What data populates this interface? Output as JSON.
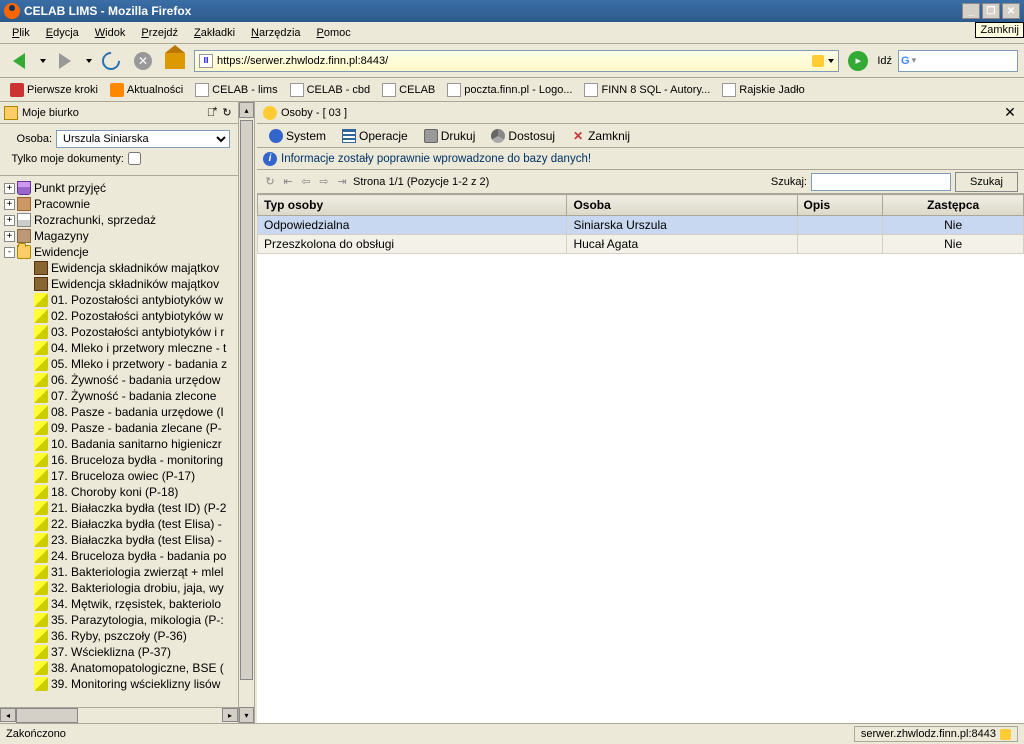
{
  "window_title": "CELAB LIMS - Mozilla Firefox",
  "close_tooltip": "Zamknij",
  "menubar": [
    "Plik",
    "Edycja",
    "Widok",
    "Przejdź",
    "Zakładki",
    "Narzędzia",
    "Pomoc"
  ],
  "url": "https://serwer.zhwlodz.finn.pl:8443/",
  "go_label": "Idź",
  "bookmarks": [
    {
      "label": "Pierwsze kroki",
      "type": "red"
    },
    {
      "label": "Aktualności",
      "type": "rss"
    },
    {
      "label": "CELAB - lims",
      "type": "page"
    },
    {
      "label": "CELAB - cbd",
      "type": "page"
    },
    {
      "label": "CELAB",
      "type": "page"
    },
    {
      "label": "poczta.finn.pl - Logo...",
      "type": "page"
    },
    {
      "label": "FINN 8 SQL - Autory...",
      "type": "page"
    },
    {
      "label": "Rajskie Jadło",
      "type": "page"
    }
  ],
  "sidebar": {
    "title": "Moje biurko",
    "filter_osoba_label": "Osoba:",
    "filter_osoba_value": "Urszula Siniarska",
    "filter_docs_label": "Tylko moje dokumenty:",
    "tree_top": [
      {
        "icon": "beaker",
        "label": "Punkt przyjęć",
        "exp": "+"
      },
      {
        "icon": "bricks",
        "label": "Pracownie",
        "exp": "+"
      },
      {
        "icon": "items",
        "label": "Rozrachunki, sprzedaż",
        "exp": "+"
      },
      {
        "icon": "box",
        "label": "Magazyny",
        "exp": "+"
      },
      {
        "icon": "folder",
        "label": "Ewidencje",
        "exp": "-"
      }
    ],
    "tree_evid_sub": [
      {
        "icon": "trunk",
        "label": "Ewidencja składników majątkov"
      },
      {
        "icon": "trunk",
        "label": "Ewidencja składników majątkov"
      }
    ],
    "tree_yellow": [
      "01. Pozostałości antybiotyków w",
      "02. Pozostałości antybiotyków w",
      "03. Pozostałości antybiotyków i r",
      "04. Mleko i przetwory mleczne - t",
      "05. Mleko i przetwory - badania z",
      "06. Żywność - badania urzędow",
      "07. Żywność - badania zlecone",
      "08. Pasze - badania urzędowe (I",
      "09. Pasze - badania zlecane (P-",
      "10. Badania sanitarno higieniczr",
      "16. Bruceloza bydła - monitoring",
      "17. Bruceloza owiec (P-17)",
      "18. Choroby koni (P-18)",
      "21. Białaczka bydła (test ID) (P-2",
      "22. Białaczka bydła (test Elisa) -",
      "23. Białaczka bydła (test Elisa) -",
      "24. Bruceloza bydła - badania po",
      "31. Bakteriologia zwierząt + mlel",
      "32. Bakteriologia drobiu, jaja, wy",
      "34. Mętwik, rzęsistek, bakteriolo",
      "35. Parazytologia, mikologia (P-:",
      "36. Ryby, pszczoły (P-36)",
      "37. Wścieklizna (P-37)",
      "38. Anatomopatologiczne, BSE (",
      "39. Monitoring wścieklizny lisów"
    ]
  },
  "main": {
    "title": "Osoby - [ 03 ]",
    "toolbar": [
      {
        "icon": "sys",
        "label": "System"
      },
      {
        "icon": "ops",
        "label": "Operacje"
      },
      {
        "icon": "print",
        "label": "Drukuj"
      },
      {
        "icon": "cfg",
        "label": "Dostosuj"
      },
      {
        "icon": "close",
        "label": "Zamknij"
      }
    ],
    "info_message": "Informacje zostały poprawnie wprowadzone do bazy danych!",
    "pager_text": "Strona 1/1 (Pozycje 1-2 z 2)",
    "search_label": "Szukaj:",
    "search_btn": "Szukaj",
    "columns": [
      "Typ osoby",
      "Osoba",
      "Opis",
      "Zastępca"
    ],
    "rows": [
      {
        "typ": "Odpowiedzialna",
        "osoba": "Siniarska Urszula",
        "opis": "",
        "zastepca": "Nie",
        "sel": true
      },
      {
        "typ": "Przeszkolona do obsługi",
        "osoba": "Hucał Agata",
        "opis": "",
        "zastepca": "Nie",
        "sel": false
      }
    ]
  },
  "status": {
    "left": "Zakończono",
    "right": "serwer.zhwlodz.finn.pl:8443"
  }
}
